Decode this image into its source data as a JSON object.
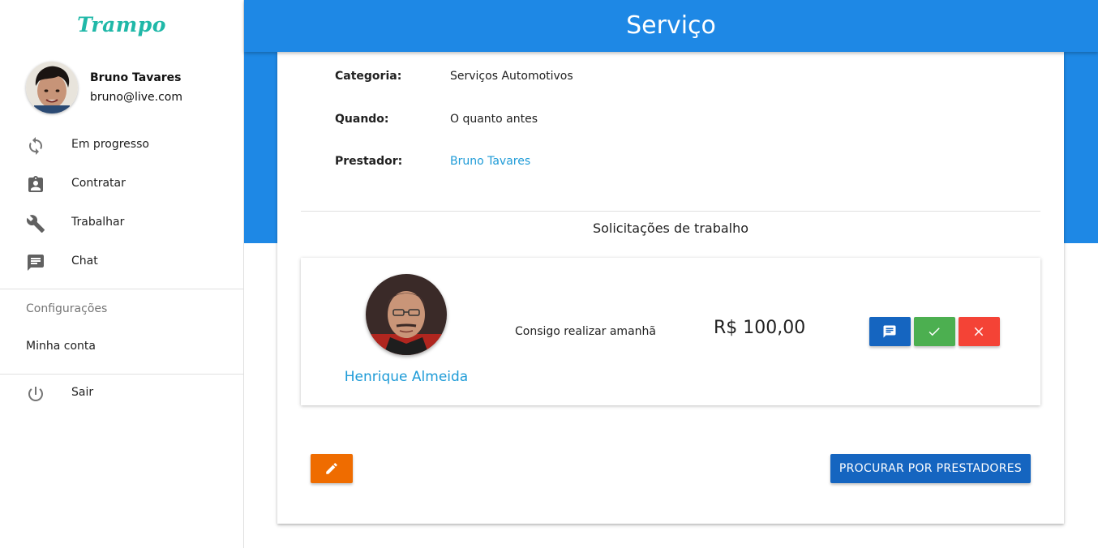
{
  "app": {
    "brand": "Trampo"
  },
  "header": {
    "title": "Serviço"
  },
  "user": {
    "name": "Bruno Tavares",
    "email": "bruno@live.com"
  },
  "nav": [
    {
      "label": "Em progresso",
      "icon": "sync-icon"
    },
    {
      "label": "Contratar",
      "icon": "assignment-ind-icon"
    },
    {
      "label": "Trabalhar",
      "icon": "wrench-icon"
    },
    {
      "label": "Chat",
      "icon": "chat-icon"
    }
  ],
  "settings": {
    "subheader": "Configurações",
    "account": "Minha conta"
  },
  "logout": {
    "label": "Sair",
    "icon": "power-icon"
  },
  "service": {
    "category_label": "Categoria:",
    "category_value": "Serviços Automotivos",
    "when_label": "Quando:",
    "when_value": "O quanto antes",
    "provider_label": "Prestador:",
    "provider_value": "Bruno Tavares"
  },
  "requests": {
    "title": "Solicitações de trabalho",
    "items": [
      {
        "name": "Henrique Almeida",
        "message": "Consigo realizar amanhã",
        "price": "R$ 100,00"
      }
    ]
  },
  "actions": {
    "search_label": "PROCURAR POR PRESTADORES"
  },
  "colors": {
    "primary": "#1e88e5",
    "primary_dark": "#1565c0",
    "accept": "#4caf50",
    "reject": "#f44336",
    "edit": "#ef6c00",
    "link": "#1e9bd7",
    "brand": "#20b8a8"
  }
}
